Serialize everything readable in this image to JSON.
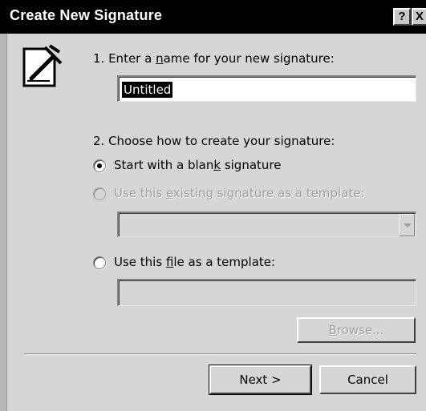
{
  "dialog": {
    "title": "Create New Signature",
    "help_label": "?",
    "close_label": "X"
  },
  "step1": {
    "prefix": "1. Enter a ",
    "accel": "n",
    "suffix": "ame for your new signature:",
    "name_value": "Untitled"
  },
  "step2": {
    "label": "2. Choose how to create your signature:",
    "options": [
      {
        "pre": "Start with a blan",
        "accel": "k",
        "post": " signature",
        "checked": true,
        "enabled": true
      },
      {
        "pre": "Use this ",
        "accel": "e",
        "post": "xisting signature as a template:",
        "checked": false,
        "enabled": false
      },
      {
        "pre": "Use this ",
        "accel": "f",
        "post": "ile as a template:",
        "checked": false,
        "enabled": true
      }
    ],
    "existing_select_value": "",
    "file_value": ""
  },
  "buttons": {
    "browse_accel": "B",
    "browse_rest": "rowse...",
    "next": "Next >",
    "cancel": "Cancel"
  },
  "icons": {
    "title_help": "help-icon",
    "title_close": "close-icon",
    "signature": "signature-pen-icon"
  }
}
